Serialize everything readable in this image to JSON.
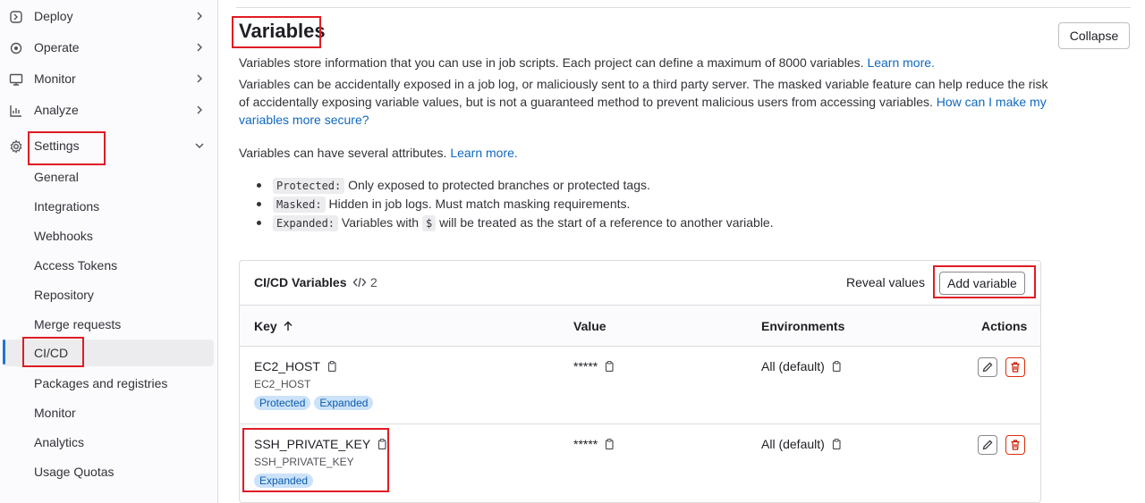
{
  "sidebar": {
    "items": [
      {
        "label": "Deploy",
        "icon": "deploy-icon"
      },
      {
        "label": "Operate",
        "icon": "operate-icon"
      },
      {
        "label": "Monitor",
        "icon": "monitor-icon"
      },
      {
        "label": "Analyze",
        "icon": "analyze-icon"
      },
      {
        "label": "Settings",
        "icon": "gear-icon"
      }
    ],
    "settings_sub": [
      "General",
      "Integrations",
      "Webhooks",
      "Access Tokens",
      "Repository",
      "Merge requests",
      "CI/CD",
      "Packages and registries",
      "Monitor",
      "Analytics",
      "Usage Quotas"
    ],
    "active_sub": "CI/CD"
  },
  "main": {
    "title": "Variables",
    "collapse_label": "Collapse",
    "intro": "Variables store information that you can use in job scripts. Each project can define a maximum of 8000 variables.",
    "intro_link": "Learn more.",
    "warning": "Variables can be accidentally exposed in a job log, or maliciously sent to a third party server. The masked variable feature can help reduce the risk of accidentally exposing variable values, but is not a guaranteed method to prevent malicious users from accessing variables.",
    "warning_link": "How can I make my variables more secure?",
    "attrs_text": "Variables can have several attributes.",
    "attrs_link": "Learn more.",
    "bullets": [
      {
        "code": "Protected:",
        "text": "Only exposed to protected branches or protected tags."
      },
      {
        "code": "Masked:",
        "text": "Hidden in job logs. Must match masking requirements."
      },
      {
        "code": "Expanded:",
        "text_before": "Variables with",
        "inline_code": "$",
        "text_after": "will be treated as the start of a reference to another variable."
      }
    ]
  },
  "card": {
    "title": "CI/CD Variables",
    "count": "2",
    "reveal_label": "Reveal values",
    "add_label": "Add variable",
    "columns": {
      "key": "Key",
      "value": "Value",
      "env": "Environments",
      "actions": "Actions"
    },
    "sort_icon": "arrow-up-icon",
    "rows": [
      {
        "key": "EC2_HOST",
        "key_sub": "EC2_HOST",
        "badges": [
          "Protected",
          "Expanded"
        ],
        "value": "*****",
        "env": "All (default)"
      },
      {
        "key": "SSH_PRIVATE_KEY",
        "key_sub": "SSH_PRIVATE_KEY",
        "badges": [
          "Expanded"
        ],
        "value": "*****",
        "env": "All (default)"
      }
    ]
  },
  "colors": {
    "accent": "#1f75cb",
    "link": "#1068bf",
    "highlight": "#e01b24",
    "badge_bg": "#cbe2f9",
    "danger": "#c91c00"
  }
}
